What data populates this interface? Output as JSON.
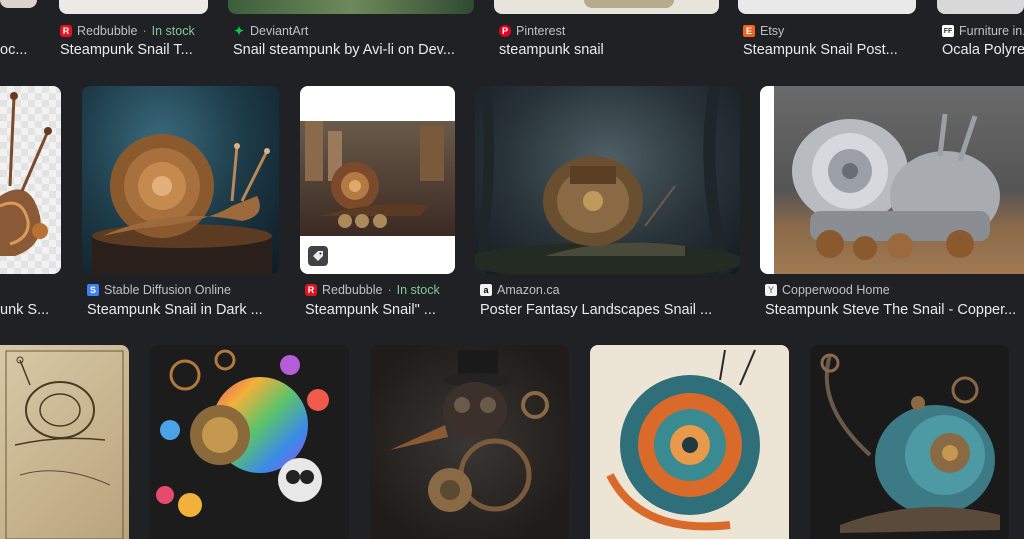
{
  "row1": [
    {
      "site": "",
      "title": "oc...",
      "favicon": "",
      "favicon_color": "#000000"
    },
    {
      "site": "Redbubble",
      "stock": "In stock",
      "title": "Steampunk Snail T...",
      "favicon": "R",
      "favicon_color": "#e41321"
    },
    {
      "site": "DeviantArt",
      "title": "Snail steampunk by Avi-li on Dev...",
      "favicon": "✦",
      "favicon_color": "#05cc47"
    },
    {
      "site": "Pinterest",
      "title": "steampunk snail",
      "favicon": "P",
      "favicon_color": "#e60023"
    },
    {
      "site": "Etsy",
      "title": "Steampunk Snail Post...",
      "favicon": "E",
      "favicon_color": "#f1641e"
    },
    {
      "site": "Furniture in...",
      "title": "Ocala Polyre",
      "favicon": "FF",
      "favicon_color": "#5f6368"
    }
  ],
  "row2": [
    {
      "site": "",
      "title": "unk S...",
      "favicon": "",
      "favicon_color": "#000000"
    },
    {
      "site": "Stable Diffusion Online",
      "title": "Steampunk Snail in Dark ...",
      "favicon": "S",
      "favicon_color": "#3b82f6"
    },
    {
      "site": "Redbubble",
      "stock": "In stock",
      "title": "Steampunk Snail\" ...",
      "favicon": "R",
      "favicon_color": "#e41321"
    },
    {
      "site": "Amazon.ca",
      "title": "Poster Fantasy Landscapes Snail ...",
      "favicon": "a",
      "favicon_color": "#000000"
    },
    {
      "site": "Copperwood Home",
      "title": "Steampunk Steve The Snail - Copper...",
      "favicon": "Y",
      "favicon_color": "#8a8a8a"
    }
  ],
  "separator": "·",
  "icons": {
    "tag": "tag-icon"
  }
}
